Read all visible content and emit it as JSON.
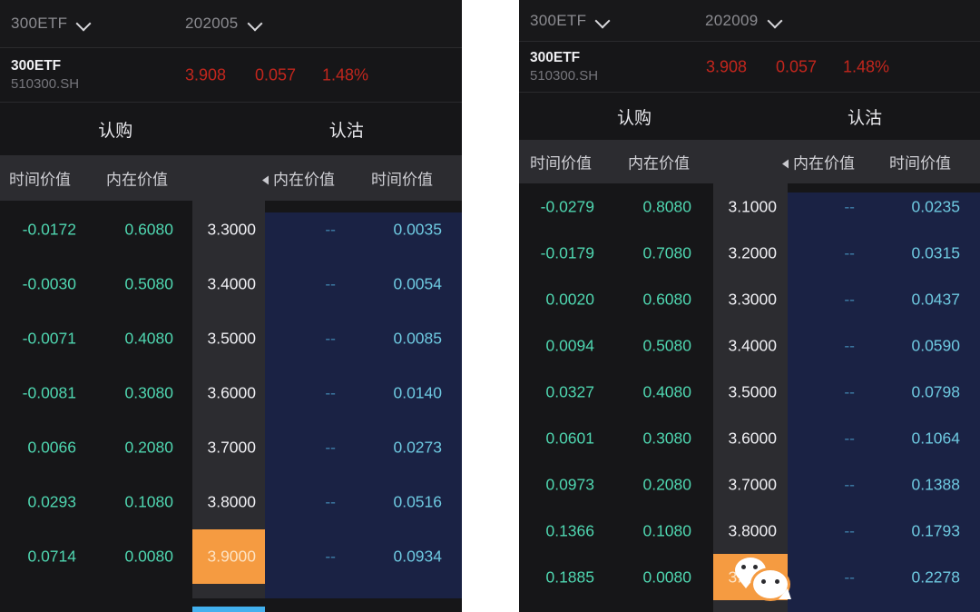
{
  "app": {
    "background": "#ffffff",
    "panel_background": "#161618",
    "accent_orange": "#f59b41",
    "accent_blue": "#42b0ee",
    "call_color": "#4fd6b0",
    "put_color": "#6ec9e0",
    "strike_color": "#f0f0f4",
    "quote_color": "#c2261d",
    "put_band_color": "#1a2244",
    "strike_band_color": "#2c2c30"
  },
  "panels": [
    {
      "id": "left",
      "selector": {
        "underlying": "300ETF",
        "underlying_icon": "chevron-down-icon",
        "month": "202005",
        "month_icon": "chevron-down-icon"
      },
      "quote": {
        "name": "300ETF",
        "code": "510300.SH",
        "price": "3.908",
        "change": "0.057",
        "change_pct": "1.48%"
      },
      "tabs": [
        {
          "label": "认购"
        },
        {
          "label": "认沽"
        }
      ],
      "columns": [
        {
          "label": "时间价值",
          "marker": ""
        },
        {
          "label": "内在价值",
          "marker": ""
        },
        {
          "label": "",
          "marker": ""
        },
        {
          "label": "内在价值",
          "marker": "triangle-left-icon"
        },
        {
          "label": "时间价值",
          "marker": ""
        }
      ],
      "highlight_strike": "3.9000",
      "rows": [
        {
          "call_time_value": "-0.0172",
          "call_intrinsic": "0.6080",
          "strike": "3.3000",
          "put_intrinsic": "--",
          "put_time_value": "0.0035"
        },
        {
          "call_time_value": "-0.0030",
          "call_intrinsic": "0.5080",
          "strike": "3.4000",
          "put_intrinsic": "--",
          "put_time_value": "0.0054"
        },
        {
          "call_time_value": "-0.0071",
          "call_intrinsic": "0.4080",
          "strike": "3.5000",
          "put_intrinsic": "--",
          "put_time_value": "0.0085"
        },
        {
          "call_time_value": "-0.0081",
          "call_intrinsic": "0.3080",
          "strike": "3.6000",
          "put_intrinsic": "--",
          "put_time_value": "0.0140"
        },
        {
          "call_time_value": "0.0066",
          "call_intrinsic": "0.2080",
          "strike": "3.7000",
          "put_intrinsic": "--",
          "put_time_value": "0.0273"
        },
        {
          "call_time_value": "0.0293",
          "call_intrinsic": "0.1080",
          "strike": "3.8000",
          "put_intrinsic": "--",
          "put_time_value": "0.0516"
        },
        {
          "call_time_value": "0.0714",
          "call_intrinsic": "0.0080",
          "strike": "3.9000",
          "put_intrinsic": "--",
          "put_time_value": "0.0934"
        }
      ]
    },
    {
      "id": "right",
      "selector": {
        "underlying": "300ETF",
        "underlying_icon": "chevron-down-icon",
        "month": "202009",
        "month_icon": "chevron-down-icon"
      },
      "quote": {
        "name": "300ETF",
        "code": "510300.SH",
        "price": "3.908",
        "change": "0.057",
        "change_pct": "1.48%"
      },
      "tabs": [
        {
          "label": "认购"
        },
        {
          "label": "认沽"
        }
      ],
      "columns": [
        {
          "label": "时间价值",
          "marker": ""
        },
        {
          "label": "内在价值",
          "marker": ""
        },
        {
          "label": "",
          "marker": ""
        },
        {
          "label": "内在价值",
          "marker": "triangle-left-icon"
        },
        {
          "label": "时间价值",
          "marker": ""
        }
      ],
      "highlight_strike": "3.9000",
      "rows": [
        {
          "call_time_value": "-0.0279",
          "call_intrinsic": "0.8080",
          "strike": "3.1000",
          "put_intrinsic": "--",
          "put_time_value": "0.0235"
        },
        {
          "call_time_value": "-0.0179",
          "call_intrinsic": "0.7080",
          "strike": "3.2000",
          "put_intrinsic": "--",
          "put_time_value": "0.0315"
        },
        {
          "call_time_value": "0.0020",
          "call_intrinsic": "0.6080",
          "strike": "3.3000",
          "put_intrinsic": "--",
          "put_time_value": "0.0437"
        },
        {
          "call_time_value": "0.0094",
          "call_intrinsic": "0.5080",
          "strike": "3.4000",
          "put_intrinsic": "--",
          "put_time_value": "0.0590"
        },
        {
          "call_time_value": "0.0327",
          "call_intrinsic": "0.4080",
          "strike": "3.5000",
          "put_intrinsic": "--",
          "put_time_value": "0.0798"
        },
        {
          "call_time_value": "0.0601",
          "call_intrinsic": "0.3080",
          "strike": "3.6000",
          "put_intrinsic": "--",
          "put_time_value": "0.1064"
        },
        {
          "call_time_value": "0.0973",
          "call_intrinsic": "0.2080",
          "strike": "3.7000",
          "put_intrinsic": "--",
          "put_time_value": "0.1388"
        },
        {
          "call_time_value": "0.1366",
          "call_intrinsic": "0.1080",
          "strike": "3.8000",
          "put_intrinsic": "--",
          "put_time_value": "0.1793"
        },
        {
          "call_time_value": "0.1885",
          "call_intrinsic": "0.0080",
          "strike": "3.9000",
          "put_intrinsic": "--",
          "put_time_value": "0.2278"
        }
      ]
    }
  ],
  "watermark": {
    "name": "wechat-logo-watermark"
  }
}
